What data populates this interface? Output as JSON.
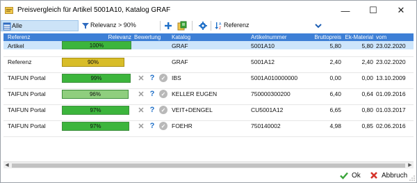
{
  "window": {
    "title": "Preisvergleich für Artikel 5001A10, Katalog GRAF",
    "minimize_glyph": "—",
    "maximize_glyph": "☐",
    "close_glyph": "✕"
  },
  "toolbar": {
    "view_label": "Alle",
    "filter_label": "Relevanz > 90%",
    "sort_label": "Referenz",
    "icons": [
      "grid-view-icon",
      "chevron-down-icon",
      "filter-icon",
      "add-icon",
      "catalog-search-icon",
      "settings-icon",
      "sort-icon"
    ]
  },
  "grid": {
    "columns": [
      "Referenz",
      "Relevanz",
      "Bewertung",
      "Katalog",
      "Artikelnummer",
      "Bruttopreis",
      "Ek-Material",
      "vom"
    ],
    "rows": [
      {
        "referenz": "Artikel",
        "relevanz": "100%",
        "relevanz_value": 100,
        "bar_color": "#3cb53c",
        "actions": false,
        "katalog": "GRAF",
        "artikelnummer": "5001A10",
        "bruttopreis": "5,80",
        "ek_material": "5,80",
        "vom": "23.02.2020",
        "selected": true
      },
      {
        "referenz": "Referenz",
        "relevanz": "90%",
        "relevanz_value": 90,
        "bar_color": "#d8bd28",
        "actions": false,
        "katalog": "GRAF",
        "artikelnummer": "5001A12",
        "bruttopreis": "2,40",
        "ek_material": "2,40",
        "vom": "23.02.2020",
        "selected": false
      },
      {
        "referenz": "TAIFUN Portal",
        "relevanz": "99%",
        "relevanz_value": 99,
        "bar_color": "#3cb53c",
        "actions": true,
        "katalog": "IBS",
        "artikelnummer": "5001A010000000",
        "bruttopreis": "0,00",
        "ek_material": "0,00",
        "vom": "13.10.2009",
        "selected": false
      },
      {
        "referenz": "TAIFUN Portal",
        "relevanz": "96%",
        "relevanz_value": 96,
        "bar_color": "#8fce7e",
        "actions": true,
        "katalog": "KELLER EUGEN",
        "artikelnummer": "750000300200",
        "bruttopreis": "6,40",
        "ek_material": "0,64",
        "vom": "01.09.2016",
        "selected": false
      },
      {
        "referenz": "TAIFUN Portal",
        "relevanz": "97%",
        "relevanz_value": 97,
        "bar_color": "#3cb53c",
        "actions": true,
        "katalog": "VEIT+DENGEL",
        "artikelnummer": "CU5001A12",
        "bruttopreis": "6,65",
        "ek_material": "0,80",
        "vom": "01.03.2017",
        "selected": false
      },
      {
        "referenz": "TAIFUN Portal",
        "relevanz": "97%",
        "relevanz_value": 97,
        "bar_color": "#3cb53c",
        "actions": true,
        "katalog": "FOEHR",
        "artikelnummer": "750140002",
        "bruttopreis": "4,98",
        "ek_material": "0,85",
        "vom": "02.06.2016",
        "selected": false
      }
    ],
    "action_glyphs": {
      "reject": "✕",
      "question": "?",
      "confirm": "✓"
    }
  },
  "buttons": {
    "ok_label": "Ok",
    "cancel_label": "Abbruch"
  },
  "colors": {
    "header_bg": "#3d7fd6",
    "selection": "#cde5fb",
    "accent_blue": "#1e6fc8",
    "ok_green": "#3aa53a",
    "cancel_red": "#d6342a"
  }
}
